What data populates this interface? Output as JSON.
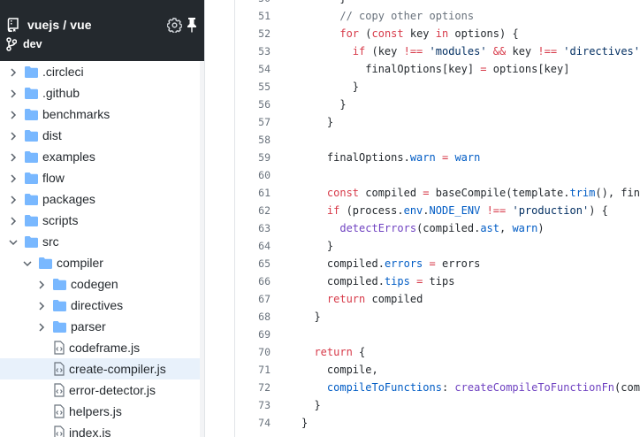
{
  "sidebar": {
    "repo_title": "vuejs / vue",
    "branch": "dev",
    "icons": {
      "repo": "repo-icon",
      "branch": "git-branch-icon",
      "settings": "gear-icon",
      "pin": "pin-icon"
    },
    "items": [
      {
        "label": ".circleci",
        "type": "folder",
        "depth": 0,
        "expanded": false
      },
      {
        "label": ".github",
        "type": "folder",
        "depth": 0,
        "expanded": false
      },
      {
        "label": "benchmarks",
        "type": "folder",
        "depth": 0,
        "expanded": false
      },
      {
        "label": "dist",
        "type": "folder",
        "depth": 0,
        "expanded": false
      },
      {
        "label": "examples",
        "type": "folder",
        "depth": 0,
        "expanded": false
      },
      {
        "label": "flow",
        "type": "folder",
        "depth": 0,
        "expanded": false
      },
      {
        "label": "packages",
        "type": "folder",
        "depth": 0,
        "expanded": false
      },
      {
        "label": "scripts",
        "type": "folder",
        "depth": 0,
        "expanded": false
      },
      {
        "label": "src",
        "type": "folder",
        "depth": 0,
        "expanded": true
      },
      {
        "label": "compiler",
        "type": "folder",
        "depth": 1,
        "expanded": true
      },
      {
        "label": "codegen",
        "type": "folder",
        "depth": 2,
        "expanded": false
      },
      {
        "label": "directives",
        "type": "folder",
        "depth": 2,
        "expanded": false
      },
      {
        "label": "parser",
        "type": "folder",
        "depth": 2,
        "expanded": false
      },
      {
        "label": "codeframe.js",
        "type": "file",
        "depth": 2
      },
      {
        "label": "create-compiler.js",
        "type": "file",
        "depth": 2,
        "active": true
      },
      {
        "label": "error-detector.js",
        "type": "file",
        "depth": 2
      },
      {
        "label": "helpers.js",
        "type": "file",
        "depth": 2
      },
      {
        "label": "index.js",
        "type": "file",
        "depth": 2
      }
    ]
  },
  "code": {
    "lines": [
      {
        "n": "50",
        "indent": 6,
        "tokens": [
          [
            "}",
            "plain"
          ]
        ]
      },
      {
        "n": "51",
        "indent": 6,
        "tokens": [
          [
            "// copy other options",
            "com"
          ]
        ]
      },
      {
        "n": "52",
        "indent": 6,
        "tokens": [
          [
            "for",
            "kw"
          ],
          [
            " (",
            "plain"
          ],
          [
            "const",
            "kw"
          ],
          [
            " key ",
            "plain"
          ],
          [
            "in",
            "kw"
          ],
          [
            " options) {",
            "plain"
          ]
        ]
      },
      {
        "n": "53",
        "indent": 8,
        "tokens": [
          [
            "if",
            "kw"
          ],
          [
            " (key ",
            "plain"
          ],
          [
            "!==",
            "kw"
          ],
          [
            " ",
            "plain"
          ],
          [
            "'modules'",
            "str"
          ],
          [
            " ",
            "plain"
          ],
          [
            "&&",
            "kw"
          ],
          [
            " key ",
            "plain"
          ],
          [
            "!==",
            "kw"
          ],
          [
            " ",
            "plain"
          ],
          [
            "'directives'",
            "str"
          ],
          [
            ") {",
            "plain"
          ]
        ]
      },
      {
        "n": "54",
        "indent": 10,
        "tokens": [
          [
            "finalOptions[key] ",
            "plain"
          ],
          [
            "=",
            "kw"
          ],
          [
            " options[key]",
            "plain"
          ]
        ]
      },
      {
        "n": "55",
        "indent": 8,
        "tokens": [
          [
            "}",
            "plain"
          ]
        ]
      },
      {
        "n": "56",
        "indent": 6,
        "tokens": [
          [
            "}",
            "plain"
          ]
        ]
      },
      {
        "n": "57",
        "indent": 4,
        "tokens": [
          [
            "}",
            "plain"
          ]
        ]
      },
      {
        "n": "58",
        "indent": 0,
        "tokens": []
      },
      {
        "n": "59",
        "indent": 4,
        "tokens": [
          [
            "finalOptions.",
            "plain"
          ],
          [
            "warn",
            "prop"
          ],
          [
            " ",
            "plain"
          ],
          [
            "=",
            "kw"
          ],
          [
            " ",
            "plain"
          ],
          [
            "warn",
            "prop"
          ]
        ]
      },
      {
        "n": "60",
        "indent": 0,
        "tokens": []
      },
      {
        "n": "61",
        "indent": 4,
        "tokens": [
          [
            "const",
            "kw"
          ],
          [
            " compiled ",
            "plain"
          ],
          [
            "=",
            "kw"
          ],
          [
            " baseCompile(template.",
            "plain"
          ],
          [
            "trim",
            "prop"
          ],
          [
            "(), finalOptions)",
            "plain"
          ]
        ]
      },
      {
        "n": "62",
        "indent": 4,
        "tokens": [
          [
            "if",
            "kw"
          ],
          [
            " (process.",
            "plain"
          ],
          [
            "env",
            "prop"
          ],
          [
            ".",
            "plain"
          ],
          [
            "NODE_ENV",
            "prop"
          ],
          [
            " ",
            "plain"
          ],
          [
            "!==",
            "kw"
          ],
          [
            " ",
            "plain"
          ],
          [
            "'production'",
            "str"
          ],
          [
            ") {",
            "plain"
          ]
        ]
      },
      {
        "n": "63",
        "indent": 6,
        "tokens": [
          [
            "detectErrors",
            "fn"
          ],
          [
            "(compiled.",
            "plain"
          ],
          [
            "ast",
            "prop"
          ],
          [
            ", ",
            "plain"
          ],
          [
            "warn",
            "prop"
          ],
          [
            ")",
            "plain"
          ]
        ]
      },
      {
        "n": "64",
        "indent": 4,
        "tokens": [
          [
            "}",
            "plain"
          ]
        ]
      },
      {
        "n": "65",
        "indent": 4,
        "tokens": [
          [
            "compiled.",
            "plain"
          ],
          [
            "errors",
            "prop"
          ],
          [
            " ",
            "plain"
          ],
          [
            "=",
            "kw"
          ],
          [
            " errors",
            "plain"
          ]
        ]
      },
      {
        "n": "66",
        "indent": 4,
        "tokens": [
          [
            "compiled.",
            "plain"
          ],
          [
            "tips",
            "prop"
          ],
          [
            " ",
            "plain"
          ],
          [
            "=",
            "kw"
          ],
          [
            " tips",
            "plain"
          ]
        ]
      },
      {
        "n": "67",
        "indent": 4,
        "tokens": [
          [
            "return",
            "kw"
          ],
          [
            " compiled",
            "plain"
          ]
        ]
      },
      {
        "n": "68",
        "indent": 2,
        "tokens": [
          [
            "}",
            "plain"
          ]
        ]
      },
      {
        "n": "69",
        "indent": 0,
        "tokens": []
      },
      {
        "n": "70",
        "indent": 2,
        "tokens": [
          [
            "return",
            "kw"
          ],
          [
            " {",
            "plain"
          ]
        ]
      },
      {
        "n": "71",
        "indent": 4,
        "tokens": [
          [
            "compile,",
            "plain"
          ]
        ]
      },
      {
        "n": "72",
        "indent": 4,
        "tokens": [
          [
            "compileToFunctions",
            "prop"
          ],
          [
            ": ",
            "plain"
          ],
          [
            "createCompileToFunctionFn",
            "fn"
          ],
          [
            "(compile)",
            "plain"
          ]
        ]
      },
      {
        "n": "73",
        "indent": 2,
        "tokens": [
          [
            "}",
            "plain"
          ]
        ]
      },
      {
        "n": "74",
        "indent": 0,
        "tokens": [
          [
            "}",
            "plain"
          ]
        ]
      }
    ]
  }
}
